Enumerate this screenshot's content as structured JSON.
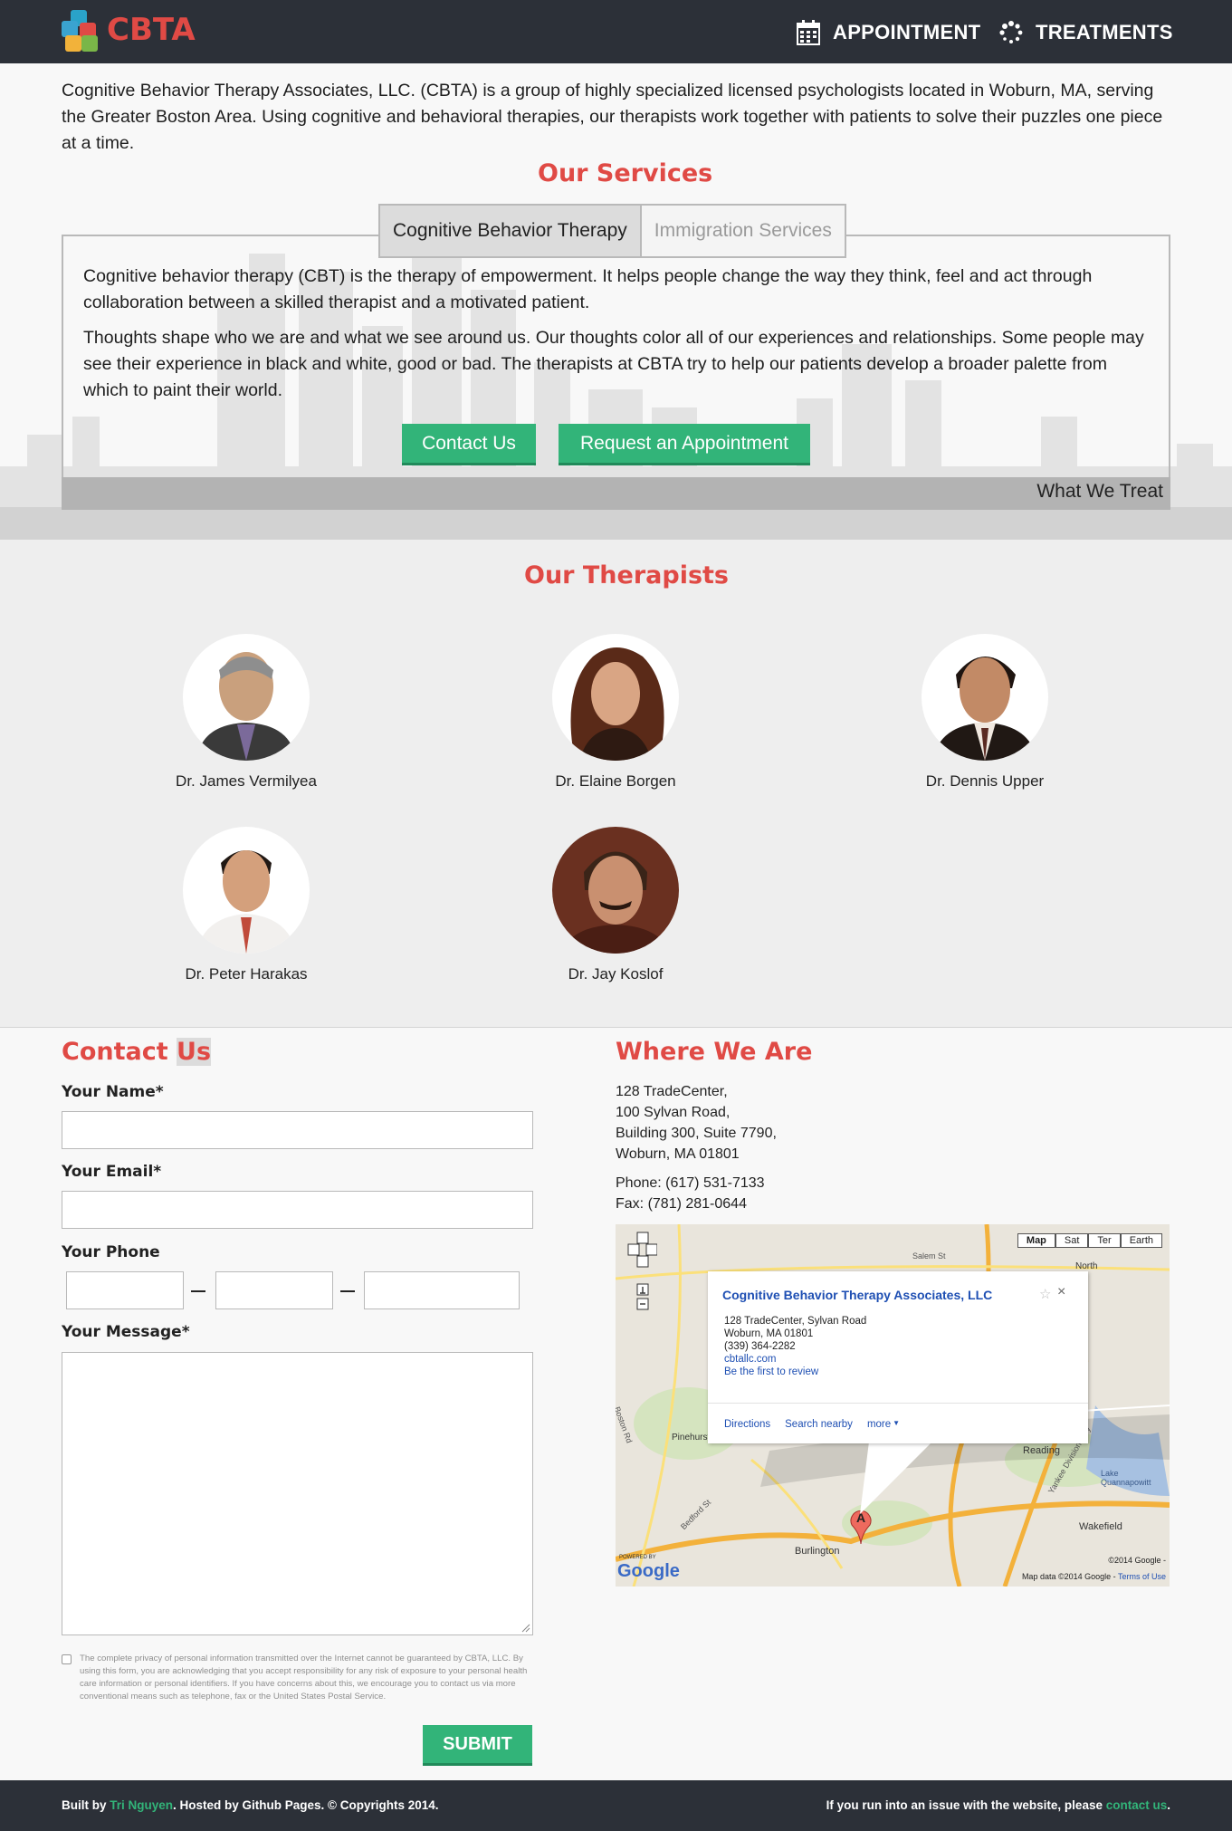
{
  "brand": {
    "name": "CBTA"
  },
  "nav": {
    "items": [
      {
        "label": "APPOINTMENT",
        "icon": "calendar-icon"
      },
      {
        "label": "TREATMENTS",
        "icon": "spinner-icon"
      }
    ]
  },
  "intro": "Cognitive Behavior Therapy Associates, LLC. (CBTA) is a group of highly specialized licensed psychologists located in Woburn, MA, serving the Greater Boston Area. Using cognitive and behavioral therapies, our therapists work together with patients to solve their puzzles one piece at a time.",
  "services": {
    "title": "Our Services",
    "tabs": [
      "Cognitive Behavior Therapy",
      "Immigration Services"
    ],
    "paragraphs": [
      "Cognitive behavior therapy (CBT) is the therapy of empowerment. It helps people change the way they think, feel and act through collaboration between a skilled therapist and a motivated patient.",
      "Thoughts shape who we are and what we see around us. Our thoughts color all of our experiences and relationships. Some people may see their experience in black and white, good or bad. The therapists at CBTA try to help our patients develop a broader palette from which to paint their world."
    ],
    "buttons": [
      "Contact Us",
      "Request an Appointment"
    ],
    "what_we_treat": "What We Treat"
  },
  "therapists": {
    "title": "Our Therapists",
    "list": [
      "Dr. James Vermilyea",
      "Dr. Elaine Borgen",
      "Dr. Dennis Upper",
      "Dr. Peter Harakas",
      "Dr. Jay Koslof"
    ]
  },
  "contact": {
    "title_part1": "Contact ",
    "title_part2": "Us",
    "name_label": "Your Name*",
    "email_label": "Your Email*",
    "phone_label": "Your Phone",
    "message_label": "Your Message*",
    "disclaimer": "The complete privacy of personal information transmitted over the Internet cannot be guaranteed by CBTA, LLC. By using this form, you are acknowledging that you accept responsibility for any risk of exposure to your personal health care information or personal identifiers. If you have concerns about this, we encourage you to contact us via more conventional means such as telephone, fax or the United States Postal Service.",
    "submit": "SUBMIT"
  },
  "location": {
    "title": "Where We Are",
    "address_lines": [
      "128 TradeCenter,",
      "100 Sylvan Road,",
      "Building 300, Suite 7790,",
      "Woburn, MA 01801"
    ],
    "phone": "Phone: (617) 531-7133",
    "fax": "Fax: (781) 281-0644"
  },
  "map": {
    "types": [
      "Map",
      "Sat",
      "Ter",
      "Earth"
    ],
    "popup_title": "Cognitive Behavior Therapy Associates, LLC",
    "popup_lines": [
      "128 TradeCenter, Sylvan Road",
      "Woburn, MA 01801",
      "(339) 364-2282"
    ],
    "popup_link1": "cbtallc.com",
    "popup_link2": "Be the first to review",
    "popup_actions": [
      "Directions",
      "Search nearby",
      "more"
    ],
    "place_labels": [
      "Burlington",
      "Reading",
      "Wakefield",
      "Pinehurst",
      "North",
      "Lake Quannapowitt",
      "Salem St",
      "Yankee Division Hwy",
      "Bedford St",
      "Boston Rd"
    ],
    "marker": "A",
    "copyright": "©2014 Google -",
    "map_data": "Map data ©2014 Google -",
    "terms": "Terms of Use",
    "powered_by": "POWERED BY",
    "google": "Google"
  },
  "footer": {
    "built_by": "Built by ",
    "author": "Tri Nguyen",
    "hosted": ". Hosted by Github Pages. © Copyrights 2014.",
    "issue": "If you run into an issue with the website, please ",
    "contact_link": "contact us",
    "period": "."
  },
  "colors": {
    "accent": "#e04a45",
    "green": "#32b479",
    "nav": "#2c3038"
  }
}
